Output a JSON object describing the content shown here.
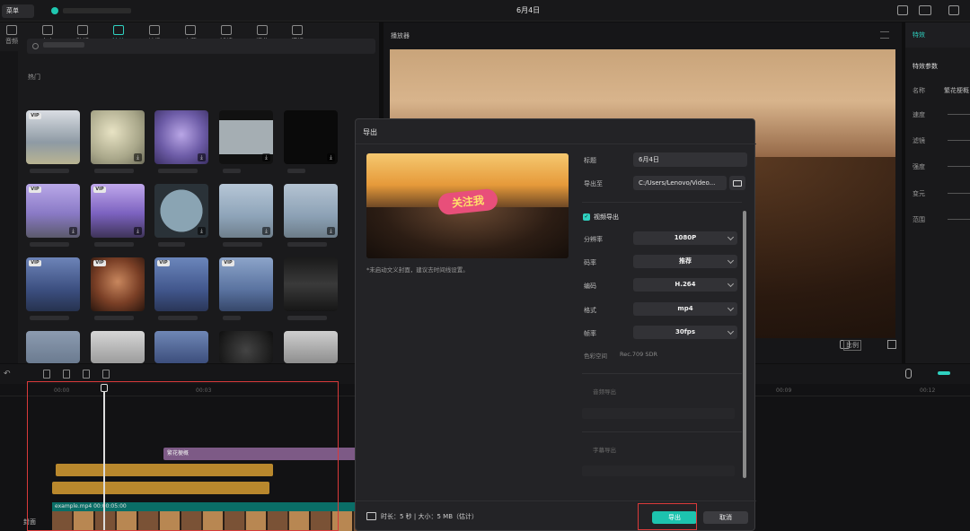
{
  "app": {
    "menu_label": "菜单",
    "document_title": "6月4日",
    "accent_color": "#2fd1c0"
  },
  "toolbar": {
    "tools": [
      {
        "label": "音频",
        "icon": "music-icon"
      },
      {
        "label": "文本",
        "icon": "text-icon"
      },
      {
        "label": "贴纸",
        "icon": "sticker-icon"
      },
      {
        "label": "特效",
        "icon": "effects-icon",
        "active": true
      },
      {
        "label": "转场",
        "icon": "transition-icon"
      },
      {
        "label": "字幕",
        "icon": "caption-icon"
      },
      {
        "label": "滤镜",
        "icon": "filter-icon"
      },
      {
        "label": "调节",
        "icon": "adjust-icon"
      },
      {
        "label": "模板",
        "icon": "template-icon"
      }
    ]
  },
  "effects_panel": {
    "section_label": "热门",
    "vip_badge": "VIP",
    "download_glyph": "⤓"
  },
  "player": {
    "title": "播放器",
    "ratio_label": "比例"
  },
  "right_panel": {
    "tab_label": "特效",
    "section_title": "特效参数",
    "params": [
      {
        "label": "名称",
        "value": "繁花梗概"
      },
      {
        "label": "速度"
      },
      {
        "label": "滤镜"
      },
      {
        "label": "强度"
      },
      {
        "label": "变元"
      },
      {
        "label": "范围"
      }
    ]
  },
  "timeline": {
    "ticks": [
      "00:00",
      "00:03",
      "00:09",
      "00:12"
    ],
    "effect_clip_label": "繁花梗概",
    "video_clip_label": "example.mp4  00:00:05:00",
    "cover_label": "封面"
  },
  "export_modal": {
    "title": "导出",
    "preview_sticker": "关注我",
    "preview_note": "*未启动文义封面，建议去时间线设置。",
    "title_label": "标题",
    "title_value": "6月4日",
    "export_to_label": "导出至",
    "export_to_value": "C:/Users/Lenovo/Video...",
    "video_export_label": "视频导出",
    "fields": [
      {
        "label": "分辨率",
        "value": "1080P"
      },
      {
        "label": "码率",
        "value": "推荐"
      },
      {
        "label": "编码",
        "value": "H.264"
      },
      {
        "label": "格式",
        "value": "mp4"
      },
      {
        "label": "帧率",
        "value": "30fps"
      }
    ],
    "color_space_label": "色彩空间",
    "color_space_value": "Rec.709 SDR",
    "audio_export_label": "音频导出",
    "subtitle_export_label": "字幕导出",
    "footer_info": "时长：5 秒 | 大小：5 MB（估计）",
    "export_button": "导出",
    "cancel_button": "取消"
  }
}
